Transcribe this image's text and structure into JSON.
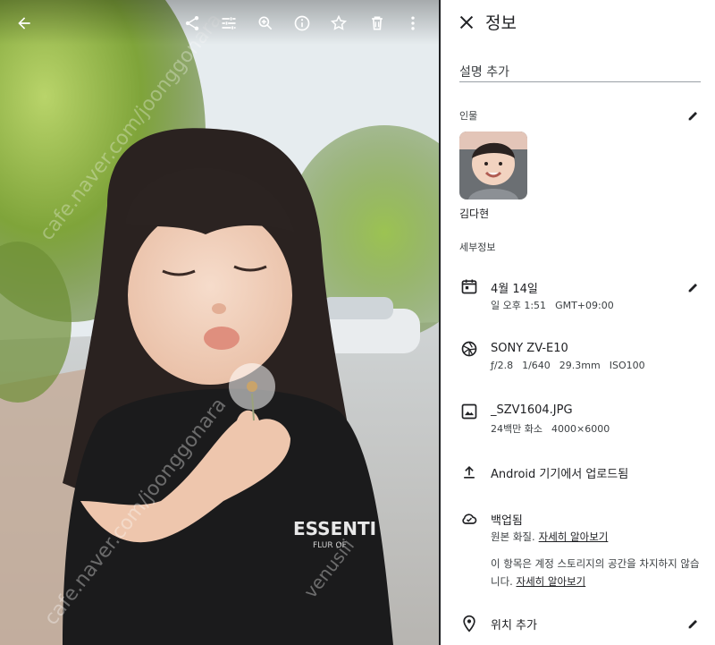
{
  "toolbar": {
    "back_icon": "arrow-back-icon",
    "icons": [
      "share-icon",
      "edit-tune-icon",
      "zoom-in-icon",
      "info-icon",
      "star-icon",
      "trash-icon",
      "more-vert-icon"
    ]
  },
  "photo": {
    "subject": "dandelion photo",
    "shirt_text": "ESSENTI",
    "shirt_subtext": "FLUR OF",
    "watermarks": [
      "cafe.naver.com/joonggonara",
      "venusiii"
    ]
  },
  "panel": {
    "title": "정보",
    "description_placeholder": "설명 추가",
    "people_label": "인물",
    "person_name": "김다현",
    "details_label": "세부정보",
    "date": {
      "main": "4월 14일",
      "time": "일 오후 1:51",
      "tz": "GMT+09:00"
    },
    "camera": {
      "model": "SONY ZV-E10",
      "aperture": "ƒ/2.8",
      "shutter": "1/640",
      "focal": "29.3mm",
      "iso": "ISO100"
    },
    "file": {
      "name": "_SZV1604.JPG",
      "megapixels": "24백만 화소",
      "resolution": "4000×6000"
    },
    "upload": "Android 기기에서 업로드됨",
    "backup": {
      "title": "백업됨",
      "quality": "원본 화질.",
      "learn_more": "자세히 알아보기",
      "note": "이 항목은 계정 스토리지의 공간을 차지하지 않습니다.",
      "note_learn_more": "자세히 알아보기"
    },
    "location": "위치 추가"
  },
  "colors": {
    "accent": "#1a73e8",
    "text": "#202124"
  }
}
